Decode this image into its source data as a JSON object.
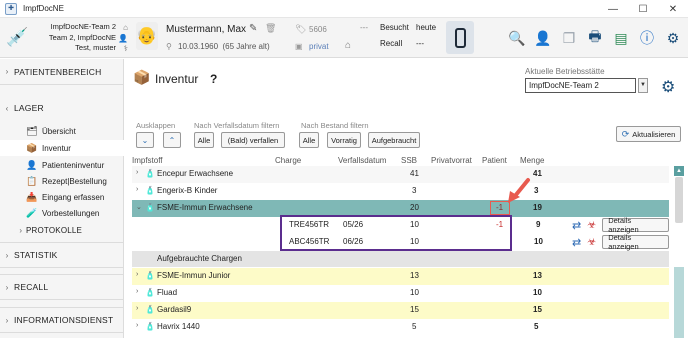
{
  "window": {
    "title": "ImpfDocNE",
    "controls": [
      "—",
      "☐",
      "✕"
    ]
  },
  "practice": {
    "lines": [
      "ImpfDocNE-Team 2",
      "Team 2, ImpfDocNE",
      "Test, muster"
    ]
  },
  "patient": {
    "name": "Mustermann, Max",
    "dob": "10.03.1960",
    "age": "(65 Jahre alt)",
    "insurance_no": "5606",
    "insurance_type": "privat",
    "dash": "---"
  },
  "visit": {
    "rows": [
      {
        "label": "Besucht",
        "value": "heute"
      },
      {
        "label": "Recall",
        "value": "---"
      }
    ]
  },
  "sidebar": {
    "sections": [
      {
        "label": "PATIENTENBEREICH",
        "chev": "›"
      },
      {
        "label": "LAGER",
        "chev": "‹"
      },
      {
        "label": "STATISTIK",
        "chev": "›"
      },
      {
        "label": "RECALL",
        "chev": "›"
      },
      {
        "label": "INFORMATIONSDIENST",
        "chev": "›"
      }
    ],
    "lager_items": [
      {
        "label": "Übersicht"
      },
      {
        "label": "Inventur"
      },
      {
        "label": "Patienteninventur"
      },
      {
        "label": "Rezept|Bestellung"
      },
      {
        "label": "Eingang erfassen"
      },
      {
        "label": "Vorbestellungen"
      }
    ],
    "protokolle": {
      "label": "PROTOKOLLE",
      "chev": "›"
    }
  },
  "page": {
    "title": "Inventur",
    "help": "?",
    "branch_label": "Aktuelle Betriebsstätte",
    "branch_value": "ImpfDocNE-Team 2",
    "filters": {
      "expand_label": "Ausklappen",
      "date_label": "Nach Verfallsdatum filtern",
      "stock_label": "Nach Bestand filtern",
      "date_buttons": [
        "Alle",
        "(Bald) verfallen"
      ],
      "stock_buttons": [
        "Alle",
        "Vorratig",
        "Aufgebraucht"
      ],
      "refresh": "Aktualisieren"
    },
    "columns": [
      "Impfstoff",
      "Charge",
      "Verfallsdatum",
      "SSB",
      "Privatvorrat",
      "Patient",
      "Menge"
    ],
    "rows": [
      {
        "name": "Encepur Erwachsene",
        "ssb": "41",
        "patient": "",
        "menge": "41"
      },
      {
        "name": "Engerix-B Kinder",
        "ssb": "3",
        "patient": "",
        "menge": "3"
      },
      {
        "name": "FSME-Immun Erwachsene",
        "ssb": "20",
        "patient": "-1",
        "menge": "19"
      }
    ],
    "sub_rows": [
      {
        "charge": "TRE456TR",
        "date": "05/26",
        "ssb": "10",
        "patient": "-1",
        "menge": "9",
        "details": "Details anzeigen"
      },
      {
        "charge": "ABC456TR",
        "date": "06/26",
        "ssb": "10",
        "patient": "",
        "menge": "10",
        "details": "Details anzeigen"
      }
    ],
    "group_label": "Aufgebrauchte Chargen",
    "rows2": [
      {
        "name": "FSME-Immun Junior",
        "ssb": "13",
        "menge": "13",
        "color": "yellow"
      },
      {
        "name": "Fluad",
        "ssb": "10",
        "menge": "10",
        "color": "white"
      },
      {
        "name": "Gardasil9",
        "ssb": "15",
        "menge": "15",
        "color": "yellow"
      },
      {
        "name": "Havrix 1440",
        "ssb": "5",
        "menge": "5",
        "color": "white"
      }
    ]
  },
  "colors": {
    "teal": "#7fb8b6",
    "yellow": "#fdfbc8",
    "accent_red": "#e85a4f",
    "highlight_purple": "#5b2d8e"
  }
}
